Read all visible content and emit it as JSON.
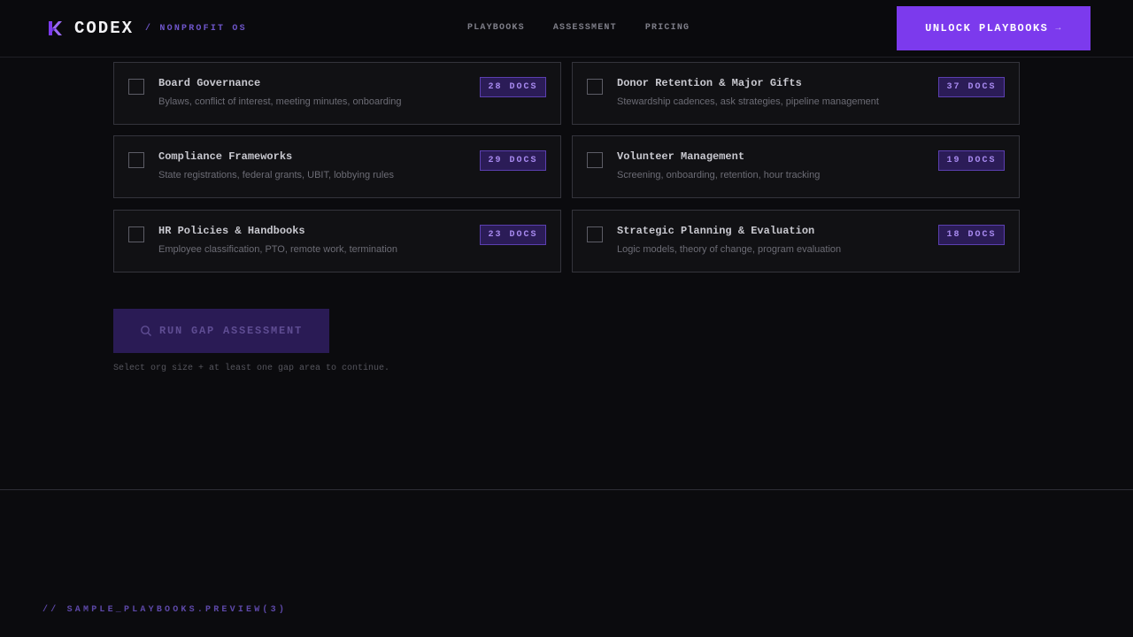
{
  "header": {
    "brand": "CODEX",
    "tagline": "/ NONPROFIT OS",
    "nav": [
      "PLAYBOOKS",
      "ASSESSMENT",
      "PRICING"
    ],
    "cta_label": "UNLOCK PLAYBOOKS",
    "cta_arrow": "→"
  },
  "gaps": [
    {
      "title": "Board Governance",
      "desc": "Bylaws, conflict of interest, meeting minutes, onboarding",
      "badge": "28 DOCS",
      "checked": false
    },
    {
      "title": "Donor Retention & Major Gifts",
      "desc": "Stewardship cadences, ask strategies, pipeline management",
      "badge": "37 DOCS",
      "checked": false
    },
    {
      "title": "Compliance Frameworks",
      "desc": "State registrations, federal grants, UBIT, lobbying rules",
      "badge": "29 DOCS",
      "checked": false
    },
    {
      "title": "Volunteer Management",
      "desc": "Screening, onboarding, retention, hour tracking",
      "badge": "19 DOCS",
      "checked": false
    },
    {
      "title": "HR Policies & Handbooks",
      "desc": "Employee classification, PTO, remote work, termination",
      "badge": "23 DOCS",
      "checked": false
    },
    {
      "title": "Strategic Planning & Evaluation",
      "desc": "Logic models, theory of change, program evaluation",
      "badge": "18 DOCS",
      "checked": false
    }
  ],
  "run_button": {
    "label": "RUN GAP ASSESSMENT",
    "disabled": true
  },
  "hint": "Select org size + at least one gap area to continue.",
  "footer": {
    "label": "// SAMPLE_PLAYBOOKS.PREVIEW(3)"
  },
  "colors": {
    "accent": "#7c3aed",
    "badge_bg": "#2b1c57",
    "badge_text": "#a88af0",
    "background": "#0b0b0e"
  }
}
